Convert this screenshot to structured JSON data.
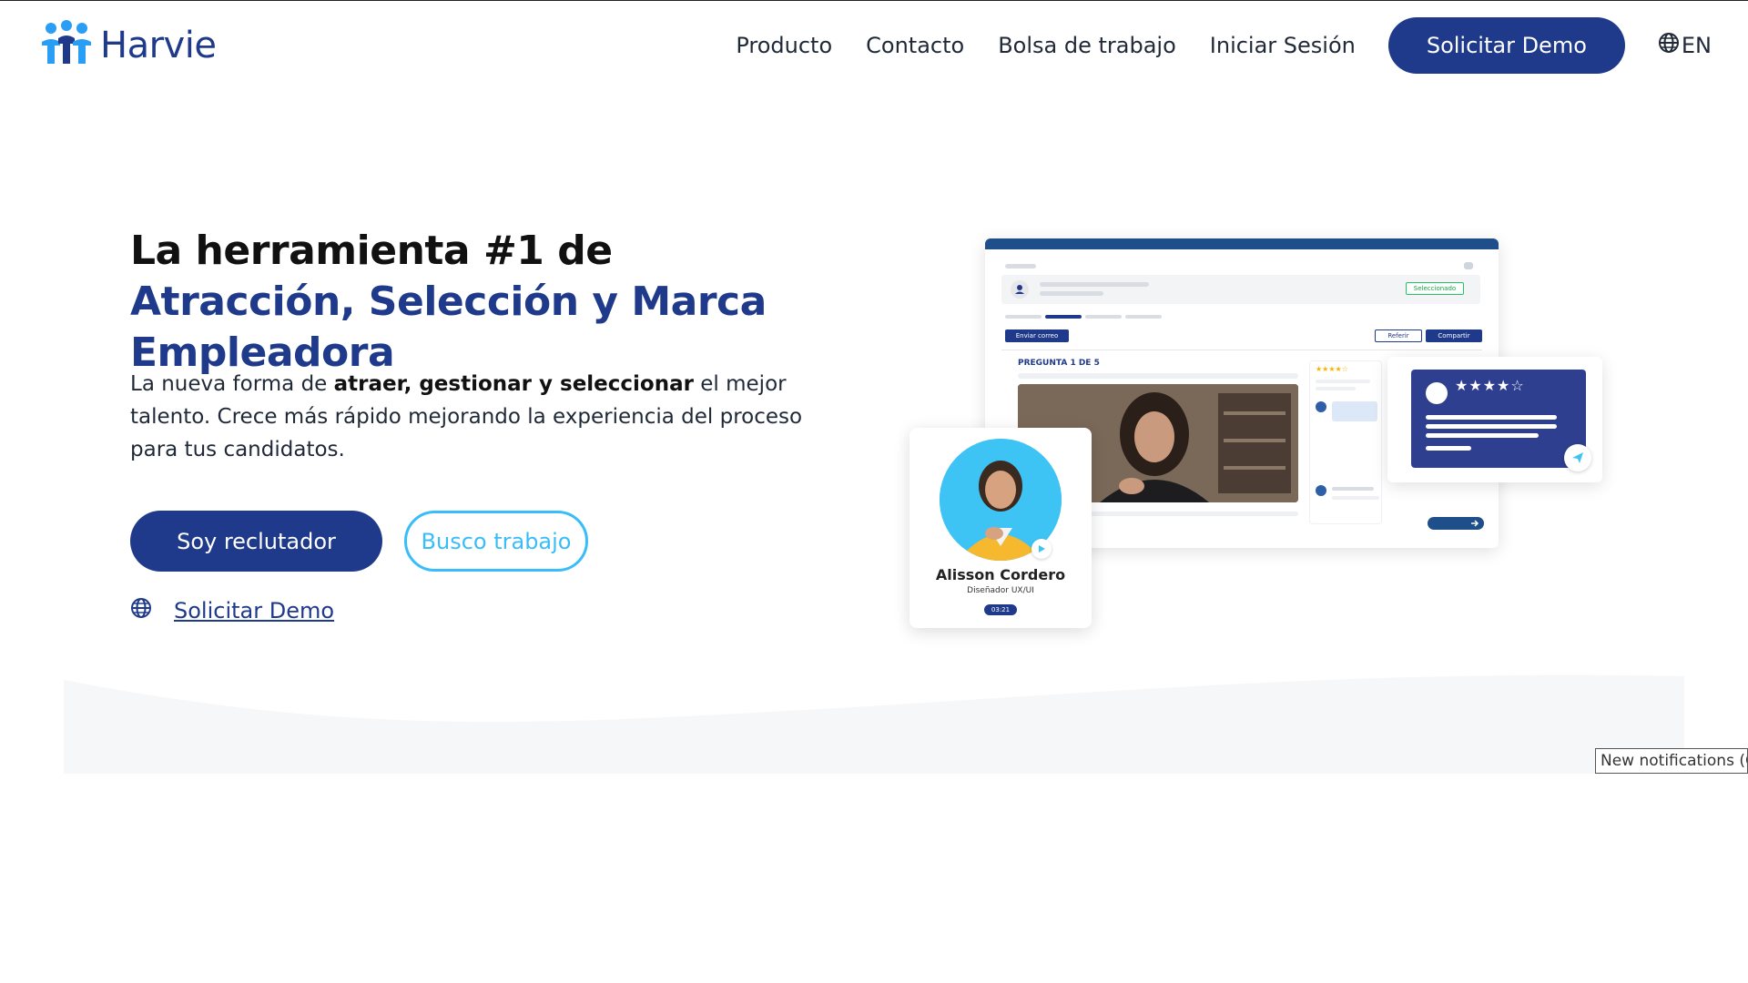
{
  "brand": {
    "name": "Harvie",
    "color_primary": "#1f3a8a",
    "color_accent": "#38bdf8"
  },
  "nav": {
    "items": [
      "Producto",
      "Contacto",
      "Bolsa de trabajo",
      "Iniciar Sesión"
    ],
    "cta": "Solicitar Demo",
    "language": "EN"
  },
  "hero": {
    "title_plain": "La herramienta #1 de ",
    "title_highlight": "Atracción, Selección y Marca Empleadora",
    "subtitle_before": "La nueva forma de ",
    "subtitle_bold": "atraer, gestionar y seleccionar",
    "subtitle_after": " el mejor talento. Crece más rápido mejorando la experiencia del proceso para tus candidatos.",
    "primary_button": "Soy reclutador",
    "secondary_button": "Busco trabajo",
    "demo_link": "Solicitar Demo"
  },
  "mockup": {
    "status_chip": "Seleccionado",
    "send_email": "Enviar correo",
    "refer": "Referir",
    "share": "Compartir",
    "question_label": "PREGUNTA 1 DE 5",
    "small_stars": "★★★★☆",
    "review_stars": "★★★★☆",
    "candidate_name": "Alisson Cordero",
    "candidate_role": "Diseñador UX/UI",
    "candidate_time": "03:21"
  },
  "notifications": {
    "label": "New notifications (O"
  }
}
